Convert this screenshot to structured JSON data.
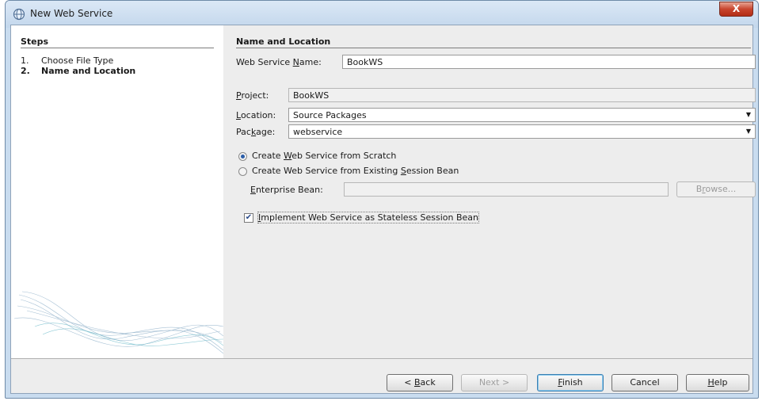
{
  "window": {
    "title": "New Web Service",
    "close_label": "X"
  },
  "steps": {
    "title": "Steps",
    "items": [
      {
        "num": "1.",
        "label": "Choose File Type"
      },
      {
        "num": "2.",
        "label": "Name and Location"
      }
    ],
    "active_index": 1
  },
  "form": {
    "section_title": "Name and Location",
    "name_label_pre": "Web Service ",
    "name_label_u": "N",
    "name_label_post": "ame:",
    "name_value": "BookWS",
    "project_label_u": "P",
    "project_label_post": "roject:",
    "project_value": "BookWS",
    "location_label_u": "L",
    "location_label_post": "ocation:",
    "location_value": "Source Packages",
    "package_label_pre": "Pac",
    "package_label_u": "k",
    "package_label_post": "age:",
    "package_value": "webservice",
    "radio_scratch": {
      "pre": "Create ",
      "u": "W",
      "post": "eb Service from Scratch",
      "selected": true
    },
    "radio_existing": {
      "pre": "Create Web Service from Existing ",
      "u": "S",
      "post": "ession Bean",
      "selected": false
    },
    "bean_label_u": "E",
    "bean_label_post": "nterprise Bean:",
    "bean_value": "",
    "browse": {
      "pre": "B",
      "u": "r",
      "post": "owse..."
    },
    "stateless": {
      "u": "I",
      "post": "mplement Web Service as Stateless Session Bean",
      "checked": true
    }
  },
  "buttons": {
    "back": {
      "pre": "< ",
      "u": "B",
      "post": "ack"
    },
    "next": "Next >",
    "finish": {
      "u": "F",
      "post": "inish"
    },
    "cancel": "Cancel",
    "help": {
      "u": "H",
      "post": "elp"
    }
  },
  "colors": {
    "title_bar": "#c3d7ec",
    "close_button": "#c8452e",
    "radio_selected": "#2a5da8"
  }
}
